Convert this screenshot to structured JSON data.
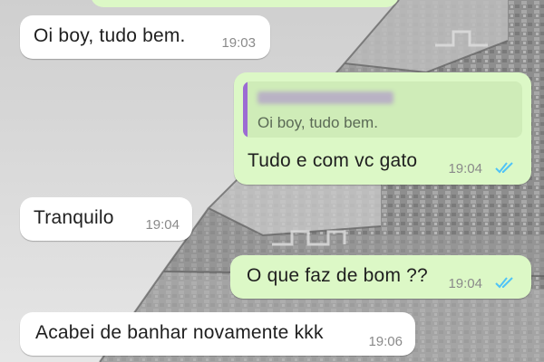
{
  "chat": {
    "messages": [
      {
        "direction": "in",
        "text": "Oi boy, tudo bem.",
        "time": "19:03"
      },
      {
        "direction": "out",
        "quoted_text": "Oi boy, tudo bem.",
        "text": "Tudo e com vc gato",
        "time": "19:04",
        "status": "read"
      },
      {
        "direction": "in",
        "text": "Tranquilo",
        "time": "19:04"
      },
      {
        "direction": "out",
        "text": "O que faz de bom ??",
        "time": "19:04",
        "status": "read"
      },
      {
        "direction": "in",
        "text": "Acabei de banhar novamente kkk",
        "time": "19:06"
      }
    ]
  },
  "colors": {
    "incoming_bubble": "#ffffff",
    "outgoing_bubble": "#dcf8c6",
    "read_ticks": "#4fc3f7",
    "quote_accent": "#9c6bd3"
  },
  "icons": {
    "read_receipt": "double-check-icon"
  }
}
